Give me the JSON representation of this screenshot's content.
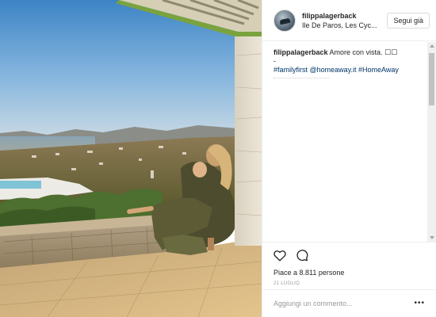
{
  "post": {
    "username": "filippalagerback",
    "location": "Ile De Paros, Les Cyc...",
    "follow_label": "Segui già",
    "caption_user": "filippalagerback",
    "caption_text": " Amore con vista. ☐☐",
    "caption_dash": "-",
    "hashtag_1": "#familyfirst",
    "mention": "@homeaway.it",
    "hashtag_2": "#HomeAway",
    "likes": "Piace a 8.811 persone",
    "date": "21 LUGLIO",
    "comment_placeholder": "Aggiungi un commento...",
    "more_label": "•••"
  },
  "icons": {
    "like": "heart-icon",
    "comment": "comment-icon",
    "photo": "sunset-terrace-photo"
  },
  "colors": {
    "link": "#003569",
    "text": "#262626",
    "muted": "#999999",
    "border": "#efefef"
  }
}
